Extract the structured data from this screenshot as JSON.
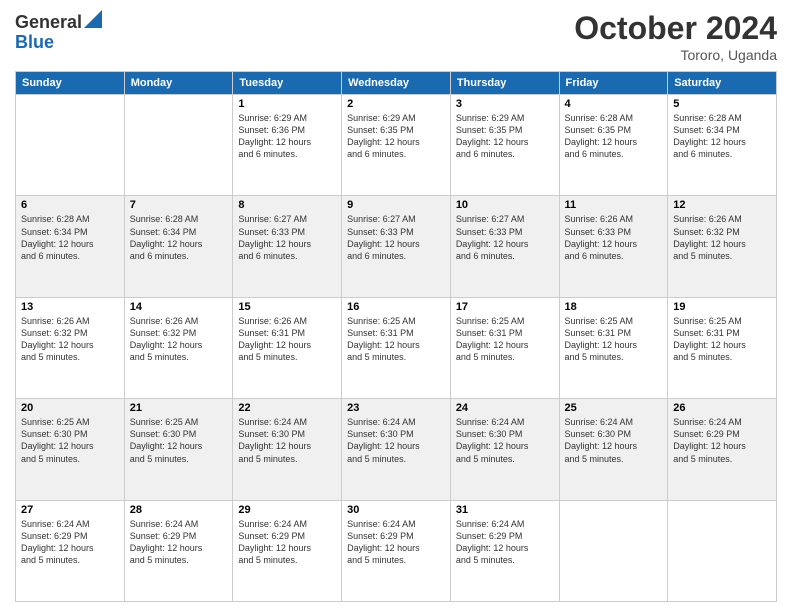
{
  "logo": {
    "line1": "General",
    "line2": "Blue"
  },
  "title": "October 2024",
  "location": "Tororo, Uganda",
  "days_of_week": [
    "Sunday",
    "Monday",
    "Tuesday",
    "Wednesday",
    "Thursday",
    "Friday",
    "Saturday"
  ],
  "weeks": [
    {
      "alt": false,
      "days": [
        {
          "num": "",
          "detail": ""
        },
        {
          "num": "",
          "detail": ""
        },
        {
          "num": "1",
          "detail": "Sunrise: 6:29 AM\nSunset: 6:36 PM\nDaylight: 12 hours\nand 6 minutes."
        },
        {
          "num": "2",
          "detail": "Sunrise: 6:29 AM\nSunset: 6:35 PM\nDaylight: 12 hours\nand 6 minutes."
        },
        {
          "num": "3",
          "detail": "Sunrise: 6:29 AM\nSunset: 6:35 PM\nDaylight: 12 hours\nand 6 minutes."
        },
        {
          "num": "4",
          "detail": "Sunrise: 6:28 AM\nSunset: 6:35 PM\nDaylight: 12 hours\nand 6 minutes."
        },
        {
          "num": "5",
          "detail": "Sunrise: 6:28 AM\nSunset: 6:34 PM\nDaylight: 12 hours\nand 6 minutes."
        }
      ]
    },
    {
      "alt": true,
      "days": [
        {
          "num": "6",
          "detail": "Sunrise: 6:28 AM\nSunset: 6:34 PM\nDaylight: 12 hours\nand 6 minutes."
        },
        {
          "num": "7",
          "detail": "Sunrise: 6:28 AM\nSunset: 6:34 PM\nDaylight: 12 hours\nand 6 minutes."
        },
        {
          "num": "8",
          "detail": "Sunrise: 6:27 AM\nSunset: 6:33 PM\nDaylight: 12 hours\nand 6 minutes."
        },
        {
          "num": "9",
          "detail": "Sunrise: 6:27 AM\nSunset: 6:33 PM\nDaylight: 12 hours\nand 6 minutes."
        },
        {
          "num": "10",
          "detail": "Sunrise: 6:27 AM\nSunset: 6:33 PM\nDaylight: 12 hours\nand 6 minutes."
        },
        {
          "num": "11",
          "detail": "Sunrise: 6:26 AM\nSunset: 6:33 PM\nDaylight: 12 hours\nand 6 minutes."
        },
        {
          "num": "12",
          "detail": "Sunrise: 6:26 AM\nSunset: 6:32 PM\nDaylight: 12 hours\nand 5 minutes."
        }
      ]
    },
    {
      "alt": false,
      "days": [
        {
          "num": "13",
          "detail": "Sunrise: 6:26 AM\nSunset: 6:32 PM\nDaylight: 12 hours\nand 5 minutes."
        },
        {
          "num": "14",
          "detail": "Sunrise: 6:26 AM\nSunset: 6:32 PM\nDaylight: 12 hours\nand 5 minutes."
        },
        {
          "num": "15",
          "detail": "Sunrise: 6:26 AM\nSunset: 6:31 PM\nDaylight: 12 hours\nand 5 minutes."
        },
        {
          "num": "16",
          "detail": "Sunrise: 6:25 AM\nSunset: 6:31 PM\nDaylight: 12 hours\nand 5 minutes."
        },
        {
          "num": "17",
          "detail": "Sunrise: 6:25 AM\nSunset: 6:31 PM\nDaylight: 12 hours\nand 5 minutes."
        },
        {
          "num": "18",
          "detail": "Sunrise: 6:25 AM\nSunset: 6:31 PM\nDaylight: 12 hours\nand 5 minutes."
        },
        {
          "num": "19",
          "detail": "Sunrise: 6:25 AM\nSunset: 6:31 PM\nDaylight: 12 hours\nand 5 minutes."
        }
      ]
    },
    {
      "alt": true,
      "days": [
        {
          "num": "20",
          "detail": "Sunrise: 6:25 AM\nSunset: 6:30 PM\nDaylight: 12 hours\nand 5 minutes."
        },
        {
          "num": "21",
          "detail": "Sunrise: 6:25 AM\nSunset: 6:30 PM\nDaylight: 12 hours\nand 5 minutes."
        },
        {
          "num": "22",
          "detail": "Sunrise: 6:24 AM\nSunset: 6:30 PM\nDaylight: 12 hours\nand 5 minutes."
        },
        {
          "num": "23",
          "detail": "Sunrise: 6:24 AM\nSunset: 6:30 PM\nDaylight: 12 hours\nand 5 minutes."
        },
        {
          "num": "24",
          "detail": "Sunrise: 6:24 AM\nSunset: 6:30 PM\nDaylight: 12 hours\nand 5 minutes."
        },
        {
          "num": "25",
          "detail": "Sunrise: 6:24 AM\nSunset: 6:30 PM\nDaylight: 12 hours\nand 5 minutes."
        },
        {
          "num": "26",
          "detail": "Sunrise: 6:24 AM\nSunset: 6:29 PM\nDaylight: 12 hours\nand 5 minutes."
        }
      ]
    },
    {
      "alt": false,
      "days": [
        {
          "num": "27",
          "detail": "Sunrise: 6:24 AM\nSunset: 6:29 PM\nDaylight: 12 hours\nand 5 minutes."
        },
        {
          "num": "28",
          "detail": "Sunrise: 6:24 AM\nSunset: 6:29 PM\nDaylight: 12 hours\nand 5 minutes."
        },
        {
          "num": "29",
          "detail": "Sunrise: 6:24 AM\nSunset: 6:29 PM\nDaylight: 12 hours\nand 5 minutes."
        },
        {
          "num": "30",
          "detail": "Sunrise: 6:24 AM\nSunset: 6:29 PM\nDaylight: 12 hours\nand 5 minutes."
        },
        {
          "num": "31",
          "detail": "Sunrise: 6:24 AM\nSunset: 6:29 PM\nDaylight: 12 hours\nand 5 minutes."
        },
        {
          "num": "",
          "detail": ""
        },
        {
          "num": "",
          "detail": ""
        }
      ]
    }
  ]
}
